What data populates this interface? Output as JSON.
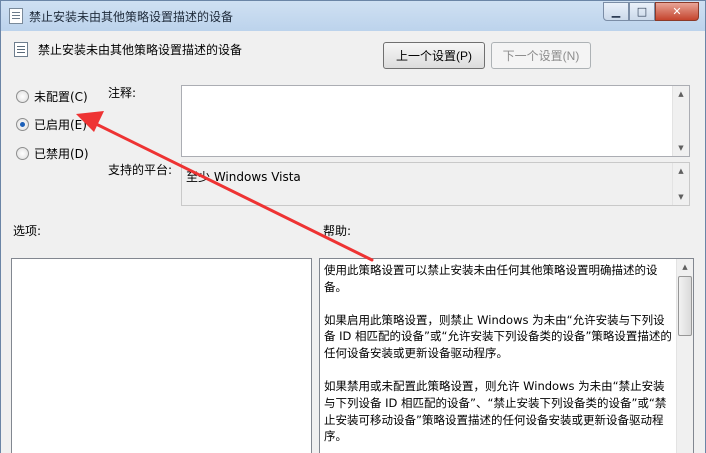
{
  "window": {
    "title": "禁止安装未由其他策略设置描述的设备",
    "buttons": {
      "minimize": "▁",
      "maximize": "□",
      "close": "✕"
    }
  },
  "header": {
    "title": "禁止安装未由其他策略设置描述的设备",
    "prev_label": "上一个设置(P)",
    "next_label": "下一个设置(N)"
  },
  "radios": [
    {
      "label": "未配置(C)",
      "checked": false
    },
    {
      "label": "已启用(E)",
      "checked": true
    },
    {
      "label": "已禁用(D)",
      "checked": false
    }
  ],
  "labels": {
    "note": "注释:",
    "support": "支持的平台:",
    "options": "选项:",
    "help": "帮助:"
  },
  "note_value": "",
  "support_value": "至少 Windows Vista",
  "help_paragraphs": [
    "使用此策略设置可以禁止安装未由任何其他策略设置明确描述的设备。",
    "如果启用此策略设置，则禁止 Windows 为未由“允许安装与下列设备 ID 相匹配的设备”或“允许安装下列设备类的设备”策略设置描述的任何设备安装或更新设备驱动程序。",
    "如果禁用或未配置此策略设置，则允许 Windows 为未由“禁止安装与下列设备 ID 相匹配的设备”、“禁止安装下列设备类的设备”或“禁止安装可移动设备”策略设置描述的任何设备安装或更新设备驱动程序。"
  ],
  "annotation_arrow_color": "#ee3333"
}
